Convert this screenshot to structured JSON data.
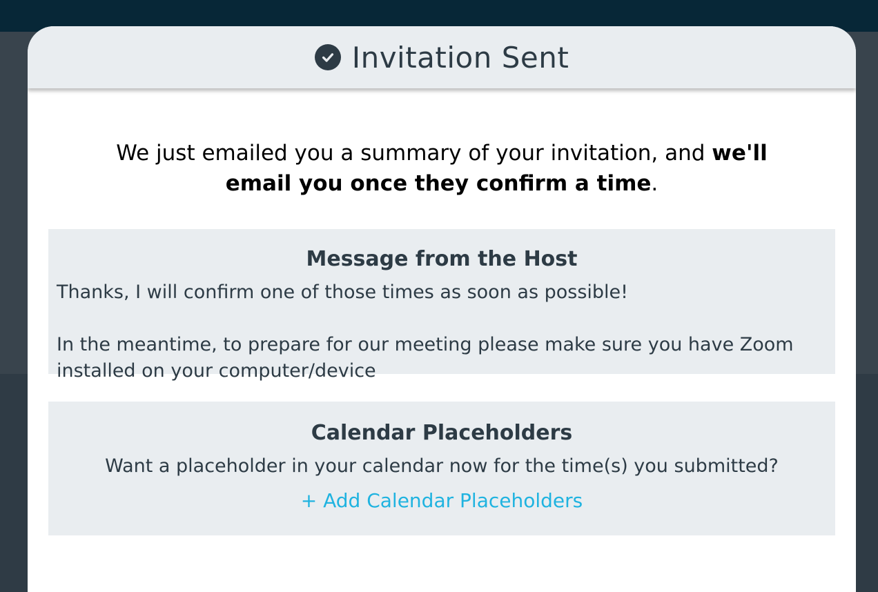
{
  "modal": {
    "title": "Invitation Sent",
    "title_icon": "check-circle-icon",
    "summary_prefix": "We just emailed you a summary of your invitation, and ",
    "summary_bold": "we'll email you once they confirm a time",
    "summary_suffix": "."
  },
  "host_message": {
    "heading": "Message from the Host",
    "line1": "Thanks, I will confirm one of those times as soon as possible!",
    "line2": "In the meantime, to prepare for our meeting please make sure you have Zoom installed on your computer/device"
  },
  "calendar": {
    "heading": "Calendar Placeholders",
    "description": "Want a placeholder in your calendar now for the time(s) you submitted?",
    "link_label": "+ Add Calendar Placeholders"
  },
  "colors": {
    "header_bg": "#e9edf0",
    "text_dark": "#2d3b45",
    "link": "#1fb3e0",
    "topbar": "#072737"
  }
}
